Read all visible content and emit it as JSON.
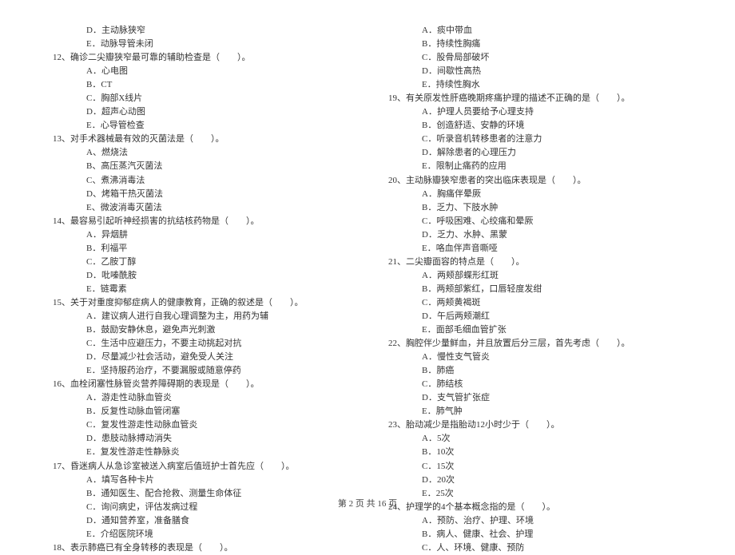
{
  "left": [
    {
      "type": "option",
      "text": "D．主动脉狭窄"
    },
    {
      "type": "option",
      "text": "E．动脉导管未闭"
    },
    {
      "type": "question",
      "text": "12、确诊二尖瓣狭窄最可靠的辅助检查是（　　）。"
    },
    {
      "type": "option",
      "text": "A．心电图"
    },
    {
      "type": "option",
      "text": "B．CT"
    },
    {
      "type": "option",
      "text": "C．胸部X线片"
    },
    {
      "type": "option",
      "text": "D．超声心动图"
    },
    {
      "type": "option",
      "text": "E．心导管检查"
    },
    {
      "type": "question",
      "text": "13、对手术器械最有效的灭菌法是（　　）。"
    },
    {
      "type": "option",
      "text": "A、燃烧法"
    },
    {
      "type": "option",
      "text": "B、高压蒸汽灭菌法"
    },
    {
      "type": "option",
      "text": "C、煮沸消毒法"
    },
    {
      "type": "option",
      "text": "D、烤箱干热灭菌法"
    },
    {
      "type": "option",
      "text": "E、微波消毒灭菌法"
    },
    {
      "type": "question",
      "text": "14、最容易引起听神经损害的抗结核药物是（　　）。"
    },
    {
      "type": "option",
      "text": "A．异烟肼"
    },
    {
      "type": "option",
      "text": "B．利福平"
    },
    {
      "type": "option",
      "text": "C．乙胺丁醇"
    },
    {
      "type": "option",
      "text": "D．吡嗪酰胺"
    },
    {
      "type": "option",
      "text": "E．链霉素"
    },
    {
      "type": "question",
      "text": "15、关于对重度抑郁症病人的健康教育，正确的叙述是（　　）。"
    },
    {
      "type": "option",
      "text": "A．建议病人进行自我心理调整为主，用药为辅"
    },
    {
      "type": "option",
      "text": "B．鼓励安静休息，避免声光刺激"
    },
    {
      "type": "option",
      "text": "C．生活中应避压力，不要主动挑起对抗"
    },
    {
      "type": "option",
      "text": "D．尽量减少社会活动，避免受人关注"
    },
    {
      "type": "option",
      "text": "E．坚持服药治疗，不要漏服或随意停药"
    },
    {
      "type": "question",
      "text": "16、血栓闭塞性脉管炎营养障碍期的表现是（　　）。"
    },
    {
      "type": "option",
      "text": "A．游走性动脉血管炎"
    },
    {
      "type": "option",
      "text": "B．反复性动脉血管闭塞"
    },
    {
      "type": "option",
      "text": "C．复发性游走性动脉血管炎"
    },
    {
      "type": "option",
      "text": "D．患肢动脉搏动消失"
    },
    {
      "type": "option",
      "text": "E．复发性游走性静脉炎"
    },
    {
      "type": "question",
      "text": "17、昏迷病人从急诊室被送入病室后值班护士首先应（　　）。"
    },
    {
      "type": "option",
      "text": "A．填写各种卡片"
    },
    {
      "type": "option",
      "text": "B．通知医生、配合抢救、测量生命体征"
    },
    {
      "type": "option",
      "text": "C．询问病史，评估发病过程"
    },
    {
      "type": "option",
      "text": "D．通知营养室，准备膳食"
    },
    {
      "type": "option",
      "text": "E．介绍医院环境"
    },
    {
      "type": "question",
      "text": "18、表示肺癌已有全身转移的表现是（　　）。"
    }
  ],
  "right": [
    {
      "type": "option",
      "text": "A．痰中带血"
    },
    {
      "type": "option",
      "text": "B．持续性胸痛"
    },
    {
      "type": "option",
      "text": "C．股骨局部破坏"
    },
    {
      "type": "option",
      "text": "D．间歇性高热"
    },
    {
      "type": "option",
      "text": "E．持续性胸水"
    },
    {
      "type": "question",
      "text": "19、有关原发性肝癌晚期疼痛护理的描述不正确的是（　　）。"
    },
    {
      "type": "option",
      "text": "A．护理人员要给予心理支持"
    },
    {
      "type": "option",
      "text": "B．创造舒适、安静的环境"
    },
    {
      "type": "option",
      "text": "C．听录音机转移患者的注意力"
    },
    {
      "type": "option",
      "text": "D．解除患者的心理压力"
    },
    {
      "type": "option",
      "text": "E．限制止痛药的应用"
    },
    {
      "type": "question",
      "text": "20、主动脉瓣狭窄患者的突出临床表现是（　　）。"
    },
    {
      "type": "option",
      "text": "A．胸痛伴晕厥"
    },
    {
      "type": "option",
      "text": "B．乏力、下肢水肿"
    },
    {
      "type": "option",
      "text": "C．呼吸困难、心绞痛和晕厥"
    },
    {
      "type": "option",
      "text": "D．乏力、水肿、黑蒙"
    },
    {
      "type": "option",
      "text": "E．咯血伴声音嘶哑"
    },
    {
      "type": "question",
      "text": "21、二尖瓣面容的特点是（　　）。"
    },
    {
      "type": "option",
      "text": "A．两颊部蝶形红斑"
    },
    {
      "type": "option",
      "text": "B．两颊部紫红，口唇轻度发绀"
    },
    {
      "type": "option",
      "text": "C．两颊黄褐斑"
    },
    {
      "type": "option",
      "text": "D．午后两颊潮红"
    },
    {
      "type": "option",
      "text": "E．面部毛细血管扩张"
    },
    {
      "type": "question",
      "text": "22、胸腔伴少量鲜血，并且放置后分三层，首先考虑（　　）。"
    },
    {
      "type": "option",
      "text": "A．慢性支气管炎"
    },
    {
      "type": "option",
      "text": "B．肺癌"
    },
    {
      "type": "option",
      "text": "C．肺结核"
    },
    {
      "type": "option",
      "text": "D．支气管扩张症"
    },
    {
      "type": "option",
      "text": "E．肺气肿"
    },
    {
      "type": "question",
      "text": "23、胎动减少是指胎动12小时少于（　　）。"
    },
    {
      "type": "option",
      "text": "A．5次"
    },
    {
      "type": "option",
      "text": "B．10次"
    },
    {
      "type": "option",
      "text": "C．15次"
    },
    {
      "type": "option",
      "text": "D．20次"
    },
    {
      "type": "option",
      "text": "E．25次"
    },
    {
      "type": "question",
      "text": "24、护理学的4个基本概念指的是（　　）。"
    },
    {
      "type": "option",
      "text": "A．预防、治疗、护理、环境"
    },
    {
      "type": "option",
      "text": "B．病人、健康、社会、护理"
    },
    {
      "type": "option",
      "text": "C．人、环境、健康、预防"
    }
  ],
  "footer": "第 2 页 共 16 页"
}
